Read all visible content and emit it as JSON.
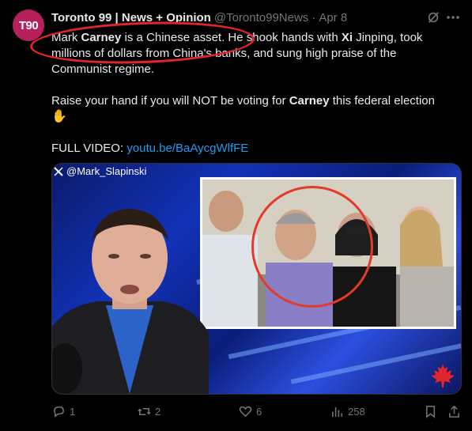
{
  "author": {
    "avatar_text": "T90",
    "name": "Toronto 99 | News + Opinion",
    "handle": "@Toronto99News",
    "separator": "·",
    "date": "Apr 8"
  },
  "tweet": {
    "p1_a": "Mark ",
    "p1_b": "Carney",
    "p1_c": " is a Chinese asset. He shook hands with ",
    "p1_d": "Xi",
    "p1_e": " Jinping, took millions of dollars from China's banks, and sung high praise of the Communist regime.",
    "p2_a": "Raise your hand if you will NOT be voting for ",
    "p2_b": "Carney",
    "p2_c": " this federal election ",
    "p2_emoji": "✋",
    "p3_label": "FULL VIDEO: ",
    "p3_link": "youtu.be/BaAycgWlfFE"
  },
  "media": {
    "watermark": "@Mark_Slapinski"
  },
  "actions": {
    "replies": "1",
    "reposts": "2",
    "likes": "6",
    "views": "258"
  },
  "colors": {
    "accent": "#1d9bf0",
    "annotation_red": "#e0262a",
    "avatar_bg": "#b51f5c"
  }
}
